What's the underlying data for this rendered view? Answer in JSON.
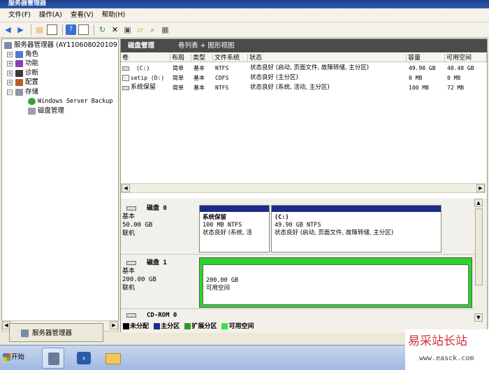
{
  "window": {
    "title": "服务器管理器"
  },
  "menu": [
    "文件(F)",
    "操作(A)",
    "查看(V)",
    "帮助(H)"
  ],
  "tree": {
    "root": "服务器管理器 (AY110608020109",
    "items": [
      "角色",
      "功能",
      "诊断",
      "配置",
      "存储"
    ],
    "children": [
      "Windows Server Backup",
      "磁盘管理"
    ]
  },
  "panel": {
    "title": "磁盘管理",
    "view": "卷列表 + 图形视图"
  },
  "columns": [
    "卷",
    "布局",
    "类型",
    "文件系统",
    "状态",
    "容量",
    "可用空间"
  ],
  "volumes": [
    {
      "name": "(C:)",
      "layout": "简单",
      "type": "基本",
      "fs": "NTFS",
      "status": "状态良好 (启动, 页面文件, 故障转储, 主分区)",
      "capacity": "49.90 GB",
      "free": "40.48 GB"
    },
    {
      "name": "setip (D:)",
      "layout": "简单",
      "type": "基本",
      "fs": "CDFS",
      "status": "状态良好 (主分区)",
      "capacity": "0 MB",
      "free": "0 MB"
    },
    {
      "name": "系统保留",
      "layout": "简单",
      "type": "基本",
      "fs": "NTFS",
      "status": "状态良好 (系统, 活动, 主分区)",
      "capacity": "100 MB",
      "free": "72 MB"
    }
  ],
  "disks": [
    {
      "name": "磁盘 0",
      "kind": "基本",
      "size": "50.00 GB",
      "state": "联机",
      "parts": [
        {
          "name": "系统保留",
          "size": "100 MB NTFS",
          "status": "状态良好 (系统, 活"
        },
        {
          "name": "(C:)",
          "size": "49.90 GB NTFS",
          "status": "状态良好 (启动, 页面文件, 故障转储, 主分区)"
        }
      ]
    },
    {
      "name": "磁盘 1",
      "kind": "基本",
      "size": "200.00 GB",
      "state": "联机",
      "parts": [
        {
          "name": "",
          "size": "200.00 GB",
          "status": "可用空间"
        }
      ]
    },
    {
      "name": "CD-ROM 0"
    }
  ],
  "legend": [
    {
      "label": "未分配",
      "color": "#000000"
    },
    {
      "label": "主分区",
      "color": "#1c2a8c"
    },
    {
      "label": "扩展分区",
      "color": "#2e9a2e"
    },
    {
      "label": "可用空间",
      "color": "#3ee03e"
    }
  ],
  "tooltip": "服务器管理器",
  "taskbar": {
    "start": "开始"
  },
  "watermark": {
    "line1": "易采站长站",
    "line2": "www.easck.com"
  },
  "colors": {
    "primary": "#1c2a8c",
    "free": "#2bd62b",
    "header": "#4b4b4b",
    "title": "#1d3f8a"
  }
}
